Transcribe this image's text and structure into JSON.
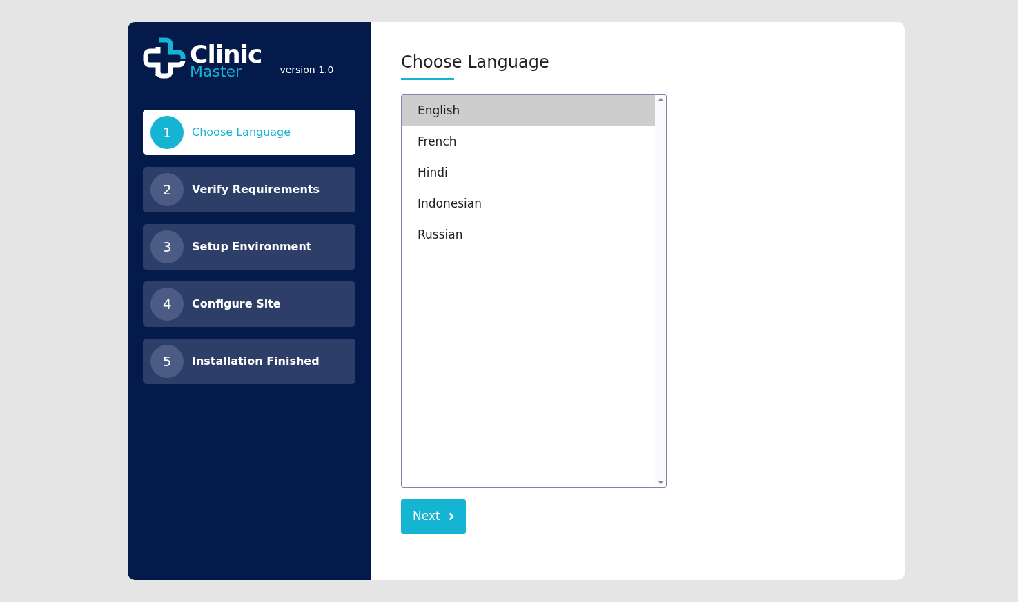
{
  "brand": {
    "name_top": "Clinic",
    "name_bottom": "Master",
    "version": "version 1.0"
  },
  "steps": [
    {
      "number": "1",
      "label": "Choose Language",
      "selected": true
    },
    {
      "number": "2",
      "label": "Verify Requirements",
      "selected": false
    },
    {
      "number": "3",
      "label": "Setup Environment",
      "selected": false
    },
    {
      "number": "4",
      "label": "Configure Site",
      "selected": false
    },
    {
      "number": "5",
      "label": "Installation Finished",
      "selected": false
    }
  ],
  "heading": "Choose Language",
  "languages": [
    {
      "label": "English",
      "selected": true
    },
    {
      "label": "French",
      "selected": false
    },
    {
      "label": "Hindi",
      "selected": false
    },
    {
      "label": "Indonesian",
      "selected": false
    },
    {
      "label": "Russian",
      "selected": false
    }
  ],
  "next_button": "Next"
}
